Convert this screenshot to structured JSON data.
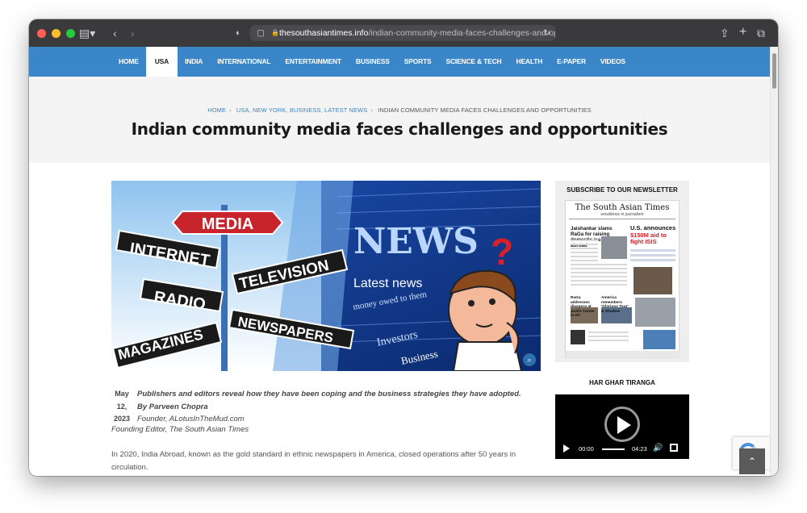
{
  "browser": {
    "url_host": "thesouthasiantimes.info",
    "url_path": "/indian-community-media-faces-challenges-and-oppo"
  },
  "nav": {
    "items": [
      "HOME",
      "USA",
      "INDIA",
      "INTERNATIONAL",
      "ENTERTAINMENT",
      "BUSINESS",
      "SPORTS",
      "SCIENCE & TECH",
      "HEALTH",
      "E-PAPER",
      "VIDEOS"
    ],
    "active": "USA"
  },
  "breadcrumb": {
    "home": "HOME",
    "cats": [
      "USA,",
      "NEW YORK,",
      "BUSINESS,",
      "LATEST NEWS"
    ],
    "current": "INDIAN COMMUNITY MEDIA FACES CHALLENGES AND OPPORTUNITIES"
  },
  "article": {
    "title": "Indian community media faces challenges and opportunities",
    "date_month": "May",
    "date_day": "12,",
    "date_year": "2023",
    "lede": "Publishers and editors reveal how they have been coping and the business strategies they have adopted.",
    "byline": "By Parveen Chopra",
    "founder": "Founder, ALotusInTheMud.com",
    "editor": "Founding Editor, The South Asian Times",
    "para1": "In 2020, India Abroad, known as the gold standard in ethnic newspapers in America, closed operations after 50 years in circulation.",
    "hero_signs": [
      "MEDIA",
      "INTERNET",
      "TELEVISION",
      "RADIO",
      "NEWSPAPERS",
      "MAGAZINES"
    ],
    "hero_words": [
      "NEWS",
      "Latest news",
      "Investors",
      "Business",
      "money owed to them"
    ]
  },
  "sidebar": {
    "newsletter_head": "SUBSCRIBE TO OUR NEWSLETTER",
    "paper_title": "The South Asian Times",
    "paper_sub": "excellence in journalism",
    "headline1": "Jaishankar slams RaGa for raising domestic issues abroad",
    "headline2_a": "U.S. announces",
    "headline2_b": "$150M aid to",
    "headline2_c": "fight ISIS",
    "caption1": "RaGa addresses diaspora at Javits Center in NY",
    "caption2": "America remembers 'Glorious Tour' & Shadow",
    "section2_head": "HAR GHAR TIRANGA",
    "video_current": "00:00",
    "video_duration": "04:23"
  }
}
